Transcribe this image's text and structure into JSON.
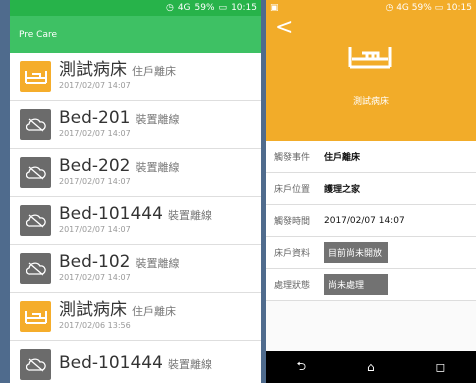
{
  "status_bar": {
    "signal": "4G",
    "battery": "59%",
    "time": "10:15"
  },
  "left": {
    "app_title": "Pre Care",
    "items": [
      {
        "name": "測試病床",
        "state": "住戶離床",
        "time": "2017/02/07 14:07",
        "type": "bed"
      },
      {
        "name": "Bed-201",
        "state": "裝置離線",
        "time": "2017/02/07 14:07",
        "type": "offline"
      },
      {
        "name": "Bed-202",
        "state": "裝置離線",
        "time": "2017/02/07 14:07",
        "type": "offline"
      },
      {
        "name": "Bed-101444",
        "state": "裝置離線",
        "time": "2017/02/07 14:07",
        "type": "offline"
      },
      {
        "name": "Bed-102",
        "state": "裝置離線",
        "time": "2017/02/07 14:07",
        "type": "offline"
      },
      {
        "name": "測試病床",
        "state": "住戶離床",
        "time": "2017/02/06 13:56",
        "type": "bed"
      },
      {
        "name": "Bed-101444",
        "state": "裝置離線",
        "time": "",
        "type": "offline"
      }
    ]
  },
  "right": {
    "back": "<",
    "header_label": "測試病床",
    "details": [
      {
        "label": "觸發事件",
        "value": "住戶離床",
        "style": "text"
      },
      {
        "label": "床戶位置",
        "value": "護理之家",
        "style": "text"
      },
      {
        "label": "觸發時間",
        "value": "2017/02/07 14:07",
        "style": "plain"
      },
      {
        "label": "床戶資料",
        "value": "目前尚未開放",
        "style": "box"
      },
      {
        "label": "處理狀態",
        "value": "尚未處理",
        "style": "box"
      }
    ],
    "nav": {
      "back": "⮌",
      "home": "⌂",
      "recent": "◻"
    }
  },
  "colors": {
    "green": "#3ec164",
    "orange": "#f2ac29",
    "gray": "#6b6b6b",
    "background": "#4f6b8d"
  }
}
